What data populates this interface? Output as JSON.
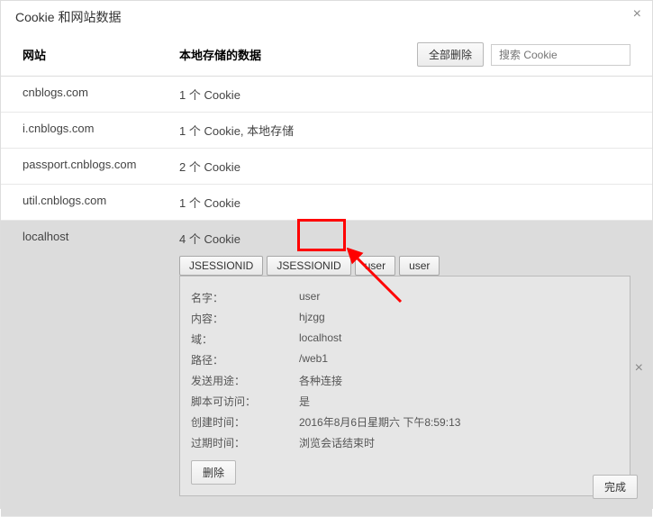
{
  "dialog": {
    "title": "Cookie 和网站数据"
  },
  "columns": {
    "site": "网站",
    "local": "本地存储的数据"
  },
  "actions": {
    "delete_all": "全部删除",
    "search_placeholder": "搜索 Cookie",
    "done": "完成",
    "delete": "删除"
  },
  "rows": [
    {
      "site": "cnblogs.com",
      "desc": "1 个 Cookie"
    },
    {
      "site": "i.cnblogs.com",
      "desc": "1 个 Cookie, 本地存储"
    },
    {
      "site": "passport.cnblogs.com",
      "desc": "2 个 Cookie"
    },
    {
      "site": "util.cnblogs.com",
      "desc": "1 个 Cookie"
    }
  ],
  "expanded": {
    "site": "localhost",
    "desc": "4 个 Cookie",
    "tags": [
      "JSESSIONID",
      "JSESSIONID",
      "user",
      "user"
    ]
  },
  "details": {
    "name_label": "名字：",
    "name_value": "user",
    "content_label": "内容：",
    "content_value": "hjzgg",
    "domain_label": "域：",
    "domain_value": "localhost",
    "path_label": "路径：",
    "path_value": "/web1",
    "send_label": "发送用途：",
    "send_value": "各种连接",
    "script_label": "脚本可访问：",
    "script_value": "是",
    "created_label": "创建时间：",
    "created_value": "2016年8月6日星期六 下午8:59:13",
    "expires_label": "过期时间：",
    "expires_value": "浏览会话结束时"
  }
}
